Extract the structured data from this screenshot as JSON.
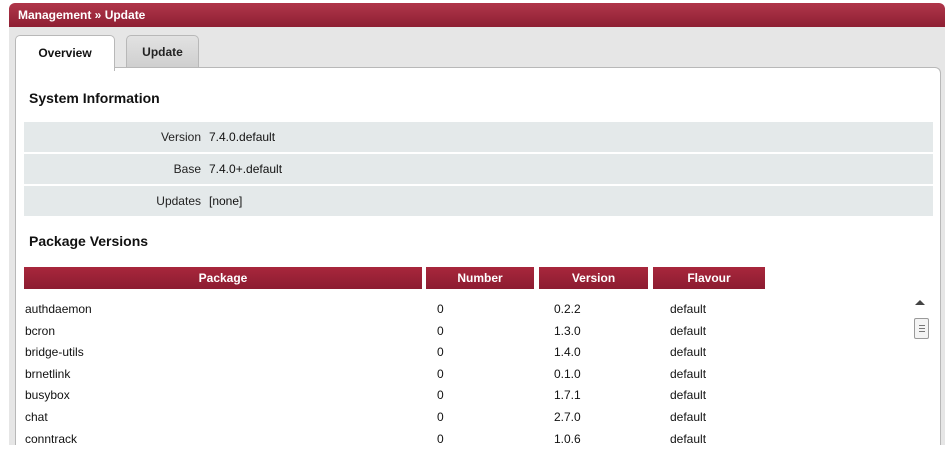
{
  "window": {
    "title": "Management » Update"
  },
  "tabs": [
    {
      "label": "Overview",
      "active": true
    },
    {
      "label": "Update",
      "active": false
    }
  ],
  "system_info": {
    "heading": "System Information",
    "rows": [
      {
        "label": "Version",
        "value": "7.4.0.default"
      },
      {
        "label": "Base",
        "value": "7.4.0+.default"
      },
      {
        "label": "Updates",
        "value": "[none]"
      }
    ]
  },
  "packages": {
    "heading": "Package Versions",
    "columns": [
      "Package",
      "Number",
      "Version",
      "Flavour"
    ],
    "rows": [
      [
        "authdaemon",
        "0",
        "0.2.2",
        "default"
      ],
      [
        "bcron",
        "0",
        "1.3.0",
        "default"
      ],
      [
        "bridge-utils",
        "0",
        "1.4.0",
        "default"
      ],
      [
        "brnetlink",
        "0",
        "0.1.0",
        "default"
      ],
      [
        "busybox",
        "0",
        "1.7.1",
        "default"
      ],
      [
        "chat",
        "0",
        "2.7.0",
        "default"
      ],
      [
        "conntrack",
        "0",
        "1.0.6",
        "default"
      ]
    ]
  },
  "colors": {
    "header_red": "#9a2337",
    "row_bg": "#e4e9ea"
  }
}
